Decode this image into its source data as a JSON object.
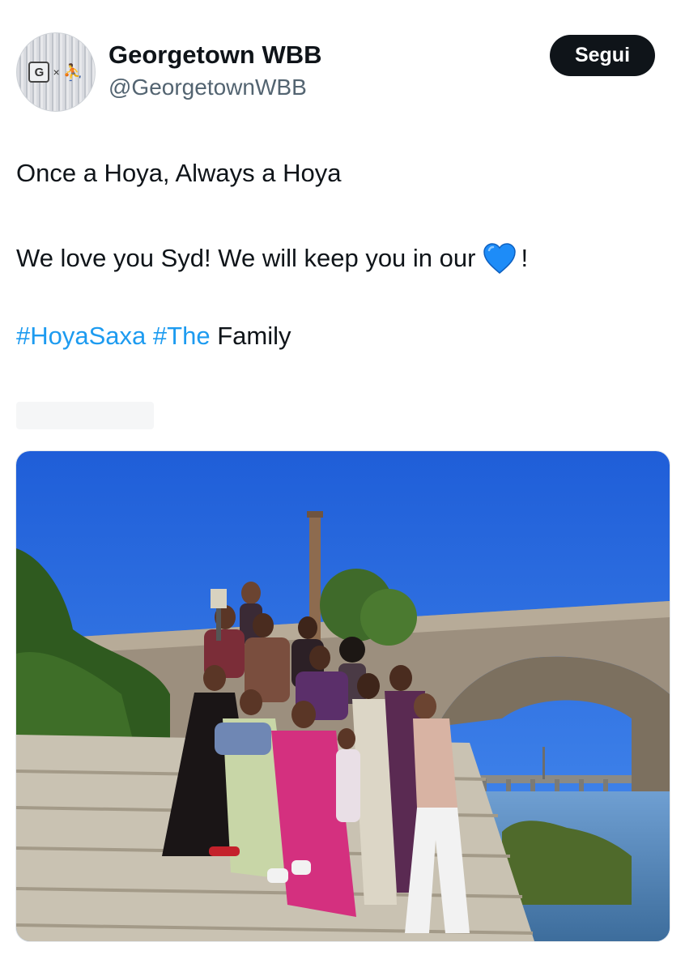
{
  "tweet": {
    "author_name": "Georgetown WBB",
    "author_handle": "@GeorgetownWBB",
    "follow_label": "Segui",
    "avatar": {
      "logo_text": "G",
      "separator": "×",
      "brand_icon": "jumpman-icon"
    },
    "line1": "Once a Hoya, Always a Hoya",
    "line2_text": "We love you Syd! We will keep you in our",
    "line2_emoji": "blue-heart-icon",
    "line2_end": "!",
    "hashtag1": "#HoyaSaxa",
    "hashtag2": "#The",
    "line3_rest": "Family"
  },
  "media": {
    "description_icon": "photo-image",
    "scene": "group of women posing on stone steps by a river under an arched stone bridge"
  },
  "colors": {
    "text_primary": "#0f1419",
    "text_secondary": "#536471",
    "link": "#1d9bf0",
    "button_bg": "#0f1419",
    "button_text": "#ffffff",
    "heart": "#1d8cf8"
  }
}
